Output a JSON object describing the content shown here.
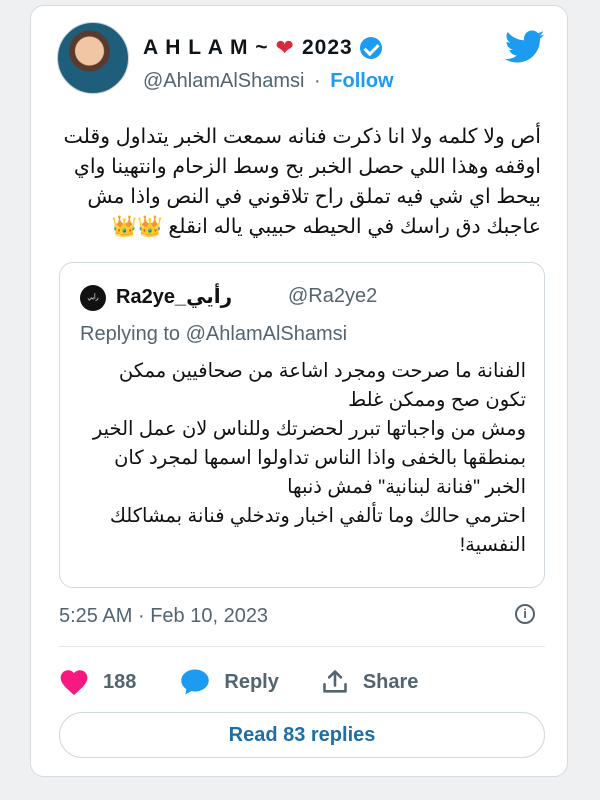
{
  "author": {
    "display_name": "A H L A M ~",
    "display_emoji": "❤",
    "display_year": "2023",
    "handle": "@AhlamAlShamsi",
    "separator": "·",
    "follow_label": "Follow",
    "verified_icon": "verified-badge-icon"
  },
  "brand": {
    "icon": "twitter-bird-icon",
    "color": "#1d9bf0"
  },
  "tweet": {
    "text": "أص ولا كلمه ولا انا ذكرت فنانه سمعت الخبر يتداول وقلت\nاوقفه وهذا اللي حصل الخبر بح وسط الزحام وانتهينا واي\nبيحط اي شي فيه تملق راح تلاقوني في النص واذا مش\nعاجبك دق راسك في الحيطه حبيبي ياله انقلع 👑👑"
  },
  "quoted": {
    "avatar_text": "رأيي Ra2ye",
    "name": "Ra2ye_رأيي",
    "handle": "@Ra2ye2",
    "replying_to": "Replying to @AhlamAlShamsi",
    "text": "الفنانة ما صرحت ومجرد اشاعة من صحافيين ممكن\nتكون صح وممكن غلط\nومش من واجباتها تبرر لحضرتك وللناس لان عمل الخير\nبمنطقها بالخفى واذا الناس تداولوا اسمها لمجرد كان\nالخبر \"فنانة لبنانية\" فمش ذنبها\nاحترمي حالك وما تألفي اخبار وتدخلي فنانة بمشاكلك\nالنفسية!"
  },
  "meta": {
    "time": "5:25 AM",
    "separator": "·",
    "date": "Feb 10, 2023",
    "info_icon": "info-icon"
  },
  "actions": {
    "like_icon": "heart-icon",
    "like_count": "188",
    "reply_icon": "speech-bubble-icon",
    "reply_label": "Reply",
    "share_icon": "share-icon",
    "share_label": "Share"
  },
  "read_replies_label": "Read 83 replies",
  "colors": {
    "accent": "#1d9bf0",
    "like": "#f91880",
    "reply_icon": "#1d9bf0",
    "muted_text": "#536471",
    "read_replies_text": "#1d6fa8"
  }
}
